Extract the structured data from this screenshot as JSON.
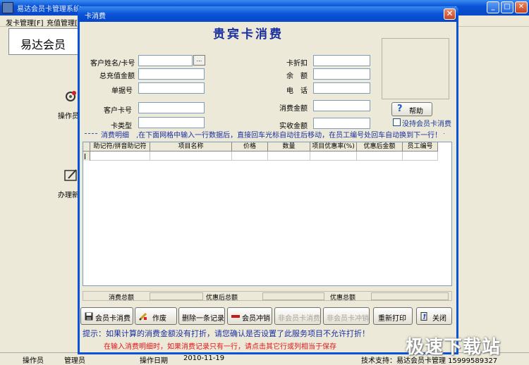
{
  "main_window": {
    "title": "易达会员卡管理系统",
    "menu": [
      "发卡管理[F]",
      "充值管理[P]"
    ],
    "banner": "易达会员",
    "side_items": [
      {
        "label": "操作员",
        "icon": "operator-icon"
      },
      {
        "label": "办理新",
        "icon": "card-edit-icon"
      }
    ],
    "status": {
      "operator_label": "操作员",
      "operator_value": "管理员",
      "date_label": "操作日期",
      "date_value": "2010-11-19",
      "support": "技术支持：易达会员卡管理 15999589327"
    }
  },
  "dialog": {
    "title": "卡消费",
    "heading": "贵宾卡消费",
    "fields_left": [
      {
        "label": "客户姓名/卡号",
        "value": ""
      },
      {
        "label": "总充值金额",
        "value": ""
      },
      {
        "label": "单据号",
        "value": ""
      },
      {
        "label": "客户卡号",
        "value": ""
      },
      {
        "label": "卡类型",
        "value": ""
      }
    ],
    "fields_right": [
      {
        "label": "卡折扣",
        "value": ""
      },
      {
        "label": "余　额",
        "value": ""
      },
      {
        "label": "电　话",
        "value": ""
      },
      {
        "label": "消费金额",
        "value": ""
      },
      {
        "label": "实收金额",
        "value": ""
      }
    ],
    "lookup_button": "...",
    "help_button": "帮助",
    "checkbox_label": "没持会员卡消费",
    "notice": "消费明细　,在下面网格中输入一行数据后，直接回车光标自动往后移动，在员工编号处回车自动换到下一行！",
    "grid_columns": [
      "助记符/拼音助记符",
      "项目名称",
      "价格",
      "数量",
      "项目优惠率(%)",
      "优惠后金额",
      "员工编号"
    ],
    "totals": {
      "total_label": "消费总额",
      "after_discount_label": "优惠后总额",
      "discount_label": "优惠总额"
    },
    "buttons": [
      {
        "label": "会员卡消费",
        "icon": "save-icon",
        "enabled": true
      },
      {
        "label": "作废",
        "icon": "pencil-icon",
        "enabled": true
      },
      {
        "label": "删除一条记录",
        "icon": "",
        "enabled": true
      },
      {
        "label": "会员冲销",
        "icon": "minus-icon",
        "enabled": true
      },
      {
        "label": "非会员卡消费",
        "icon": "",
        "enabled": false
      },
      {
        "label": "非会员卡冲销",
        "icon": "",
        "enabled": false
      },
      {
        "label": "重新打印",
        "icon": "",
        "enabled": true
      },
      {
        "label": "关闭",
        "icon": "exit-icon",
        "enabled": true
      }
    ],
    "tip1": "提示：如果计算的消费金额没有打折，请您确认是否设置了此服务项目不允许打折！",
    "tip2": "在输入消费明细时，如果消费记录只有一行，请点击其它行或列相当于保存"
  },
  "watermark": "极速下载站",
  "colors": {
    "title_blue": "#0a53d8",
    "heading_blue": "#1a2fa0",
    "warning_red": "#e01818",
    "face": "#ece9d8"
  }
}
